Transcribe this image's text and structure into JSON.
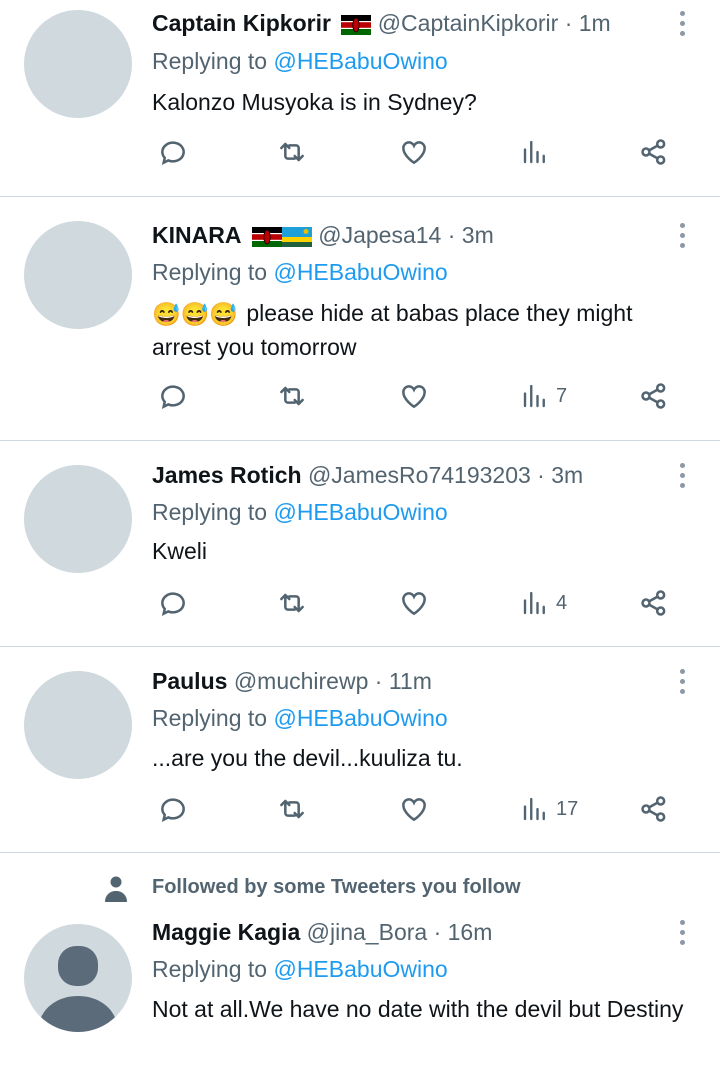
{
  "tweets": [
    {
      "name": "Captain Kipkorir",
      "flags": [
        "kenya"
      ],
      "handle": "@CaptainKipkorir",
      "time": "1m",
      "replying_prefix": "Replying to",
      "replying_to": "@HEBabuOwino",
      "text": "Kalonzo Musyoka is in Sydney?",
      "views": ""
    },
    {
      "name": "KINARA",
      "flags": [
        "kenya",
        "rwanda"
      ],
      "handle": "@Japesa14",
      "time": "3m",
      "replying_prefix": "Replying to",
      "replying_to": "@HEBabuOwino",
      "emoji_prefix": "😅😅😅",
      "text": "please hide at babas place they might arrest you tomorrow",
      "views": "7"
    },
    {
      "name": "James Rotich",
      "flags": [],
      "handle": "@JamesRo74193203",
      "time": "3m",
      "replying_prefix": "Replying to",
      "replying_to": "@HEBabuOwino",
      "text": "Kweli",
      "views": "4"
    },
    {
      "name": "Paulus",
      "flags": [],
      "handle": "@muchirewp",
      "time": "11m",
      "replying_prefix": "Replying to",
      "replying_to": "@HEBabuOwino",
      "text": "...are you the devil...kuuliza tu.",
      "views": "17"
    },
    {
      "social_context": "Followed by some Tweeters you follow",
      "name": "Maggie Kagia",
      "flags": [],
      "handle": "@jina_Bora",
      "time": "16m",
      "replying_prefix": "Replying to",
      "replying_to": "@HEBabuOwino",
      "text": "Not at all.We have no date with the devil but Destiny",
      "views": ""
    }
  ],
  "separator": "·",
  "icons": {
    "reply": "reply-icon",
    "retweet": "retweet-icon",
    "like": "heart-icon",
    "views": "views-icon",
    "share": "share-icon",
    "more": "more-options-icon",
    "person": "person-icon"
  },
  "colors": {
    "link": "#1d9bf0",
    "secondary_text": "#536471",
    "divider": "#cfd9de",
    "avatar_placeholder": "#cfd9de"
  }
}
